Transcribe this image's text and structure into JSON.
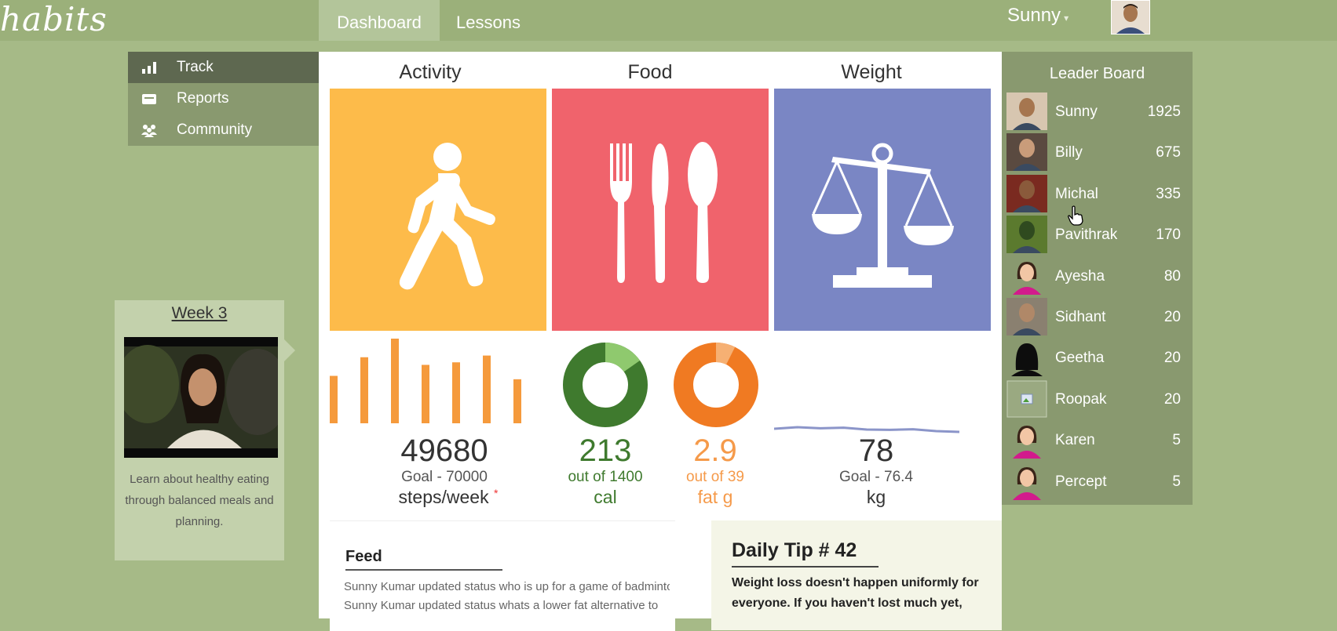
{
  "app": {
    "logo": "habits"
  },
  "nav": {
    "tabs": [
      {
        "label": "Dashboard",
        "active": true
      },
      {
        "label": "Lessons",
        "active": false
      }
    ],
    "user": {
      "name": "Sunny"
    }
  },
  "sidebar": {
    "items": [
      {
        "label": "Track",
        "icon": "bar-chart-icon",
        "active": true
      },
      {
        "label": "Reports",
        "icon": "inbox-icon",
        "active": false
      },
      {
        "label": "Community",
        "icon": "people-icon",
        "active": false
      }
    ]
  },
  "week": {
    "title": "Week 3",
    "description": "Learn about healthy eating through balanced meals and planning."
  },
  "dashboard": {
    "activity": {
      "title": "Activity",
      "icon": "walking-person-icon",
      "color": "#fdbb4a",
      "bars": [
        0.56,
        0.78,
        1.0,
        0.69,
        0.72,
        0.8,
        0.52
      ],
      "value": "49680",
      "goal": "Goal - 70000",
      "unit": "steps/week",
      "marker": "*"
    },
    "food": {
      "title": "Food",
      "icon": "fork-knife-spoon-icon",
      "color": "#f0636c",
      "cal": {
        "value": "213",
        "sub": "out of 1400",
        "unit": "cal",
        "fraction": 0.152,
        "color": "#3f7a2e",
        "light": "#8fc96e"
      },
      "fat": {
        "value": "2.9",
        "sub": "out of 39",
        "unit": "fat g",
        "fraction": 0.074,
        "color": "#f07a22",
        "light": "#f6b073"
      }
    },
    "weight": {
      "title": "Weight",
      "icon": "balance-scale-icon",
      "color": "#7a86c4",
      "trend": [
        0.55,
        0.45,
        0.52,
        0.48,
        0.6,
        0.62,
        0.58,
        0.7,
        0.75
      ],
      "value": "78",
      "goal": "Goal - 76.4",
      "unit": "kg"
    }
  },
  "feed": {
    "title": "Feed",
    "items": [
      "Sunny Kumar updated status who is up for a game of badminton",
      "Sunny Kumar updated status whats a lower fat alternative to"
    ]
  },
  "tip": {
    "title": "Daily Tip # 42",
    "text": "Weight loss doesn't happen uniformly for everyone. If you haven't lost much yet,"
  },
  "leaderboard": {
    "title": "Leader Board",
    "rows": [
      {
        "name": "Sunny",
        "score": "1925",
        "avatar": "photo"
      },
      {
        "name": "Billy",
        "score": "675",
        "avatar": "photo"
      },
      {
        "name": "Michal",
        "score": "335",
        "avatar": "photo"
      },
      {
        "name": "Pavithrak",
        "score": "170",
        "avatar": "photo"
      },
      {
        "name": "Ayesha",
        "score": "80",
        "avatar": "female-silhouette"
      },
      {
        "name": "Sidhant",
        "score": "20",
        "avatar": "photo"
      },
      {
        "name": "Geetha",
        "score": "20",
        "avatar": "black-silhouette"
      },
      {
        "name": "Roopak",
        "score": "20",
        "avatar": "broken-image"
      },
      {
        "name": "Karen",
        "score": "5",
        "avatar": "female-silhouette"
      },
      {
        "name": "Percept",
        "score": "5",
        "avatar": "female-silhouette"
      }
    ]
  }
}
